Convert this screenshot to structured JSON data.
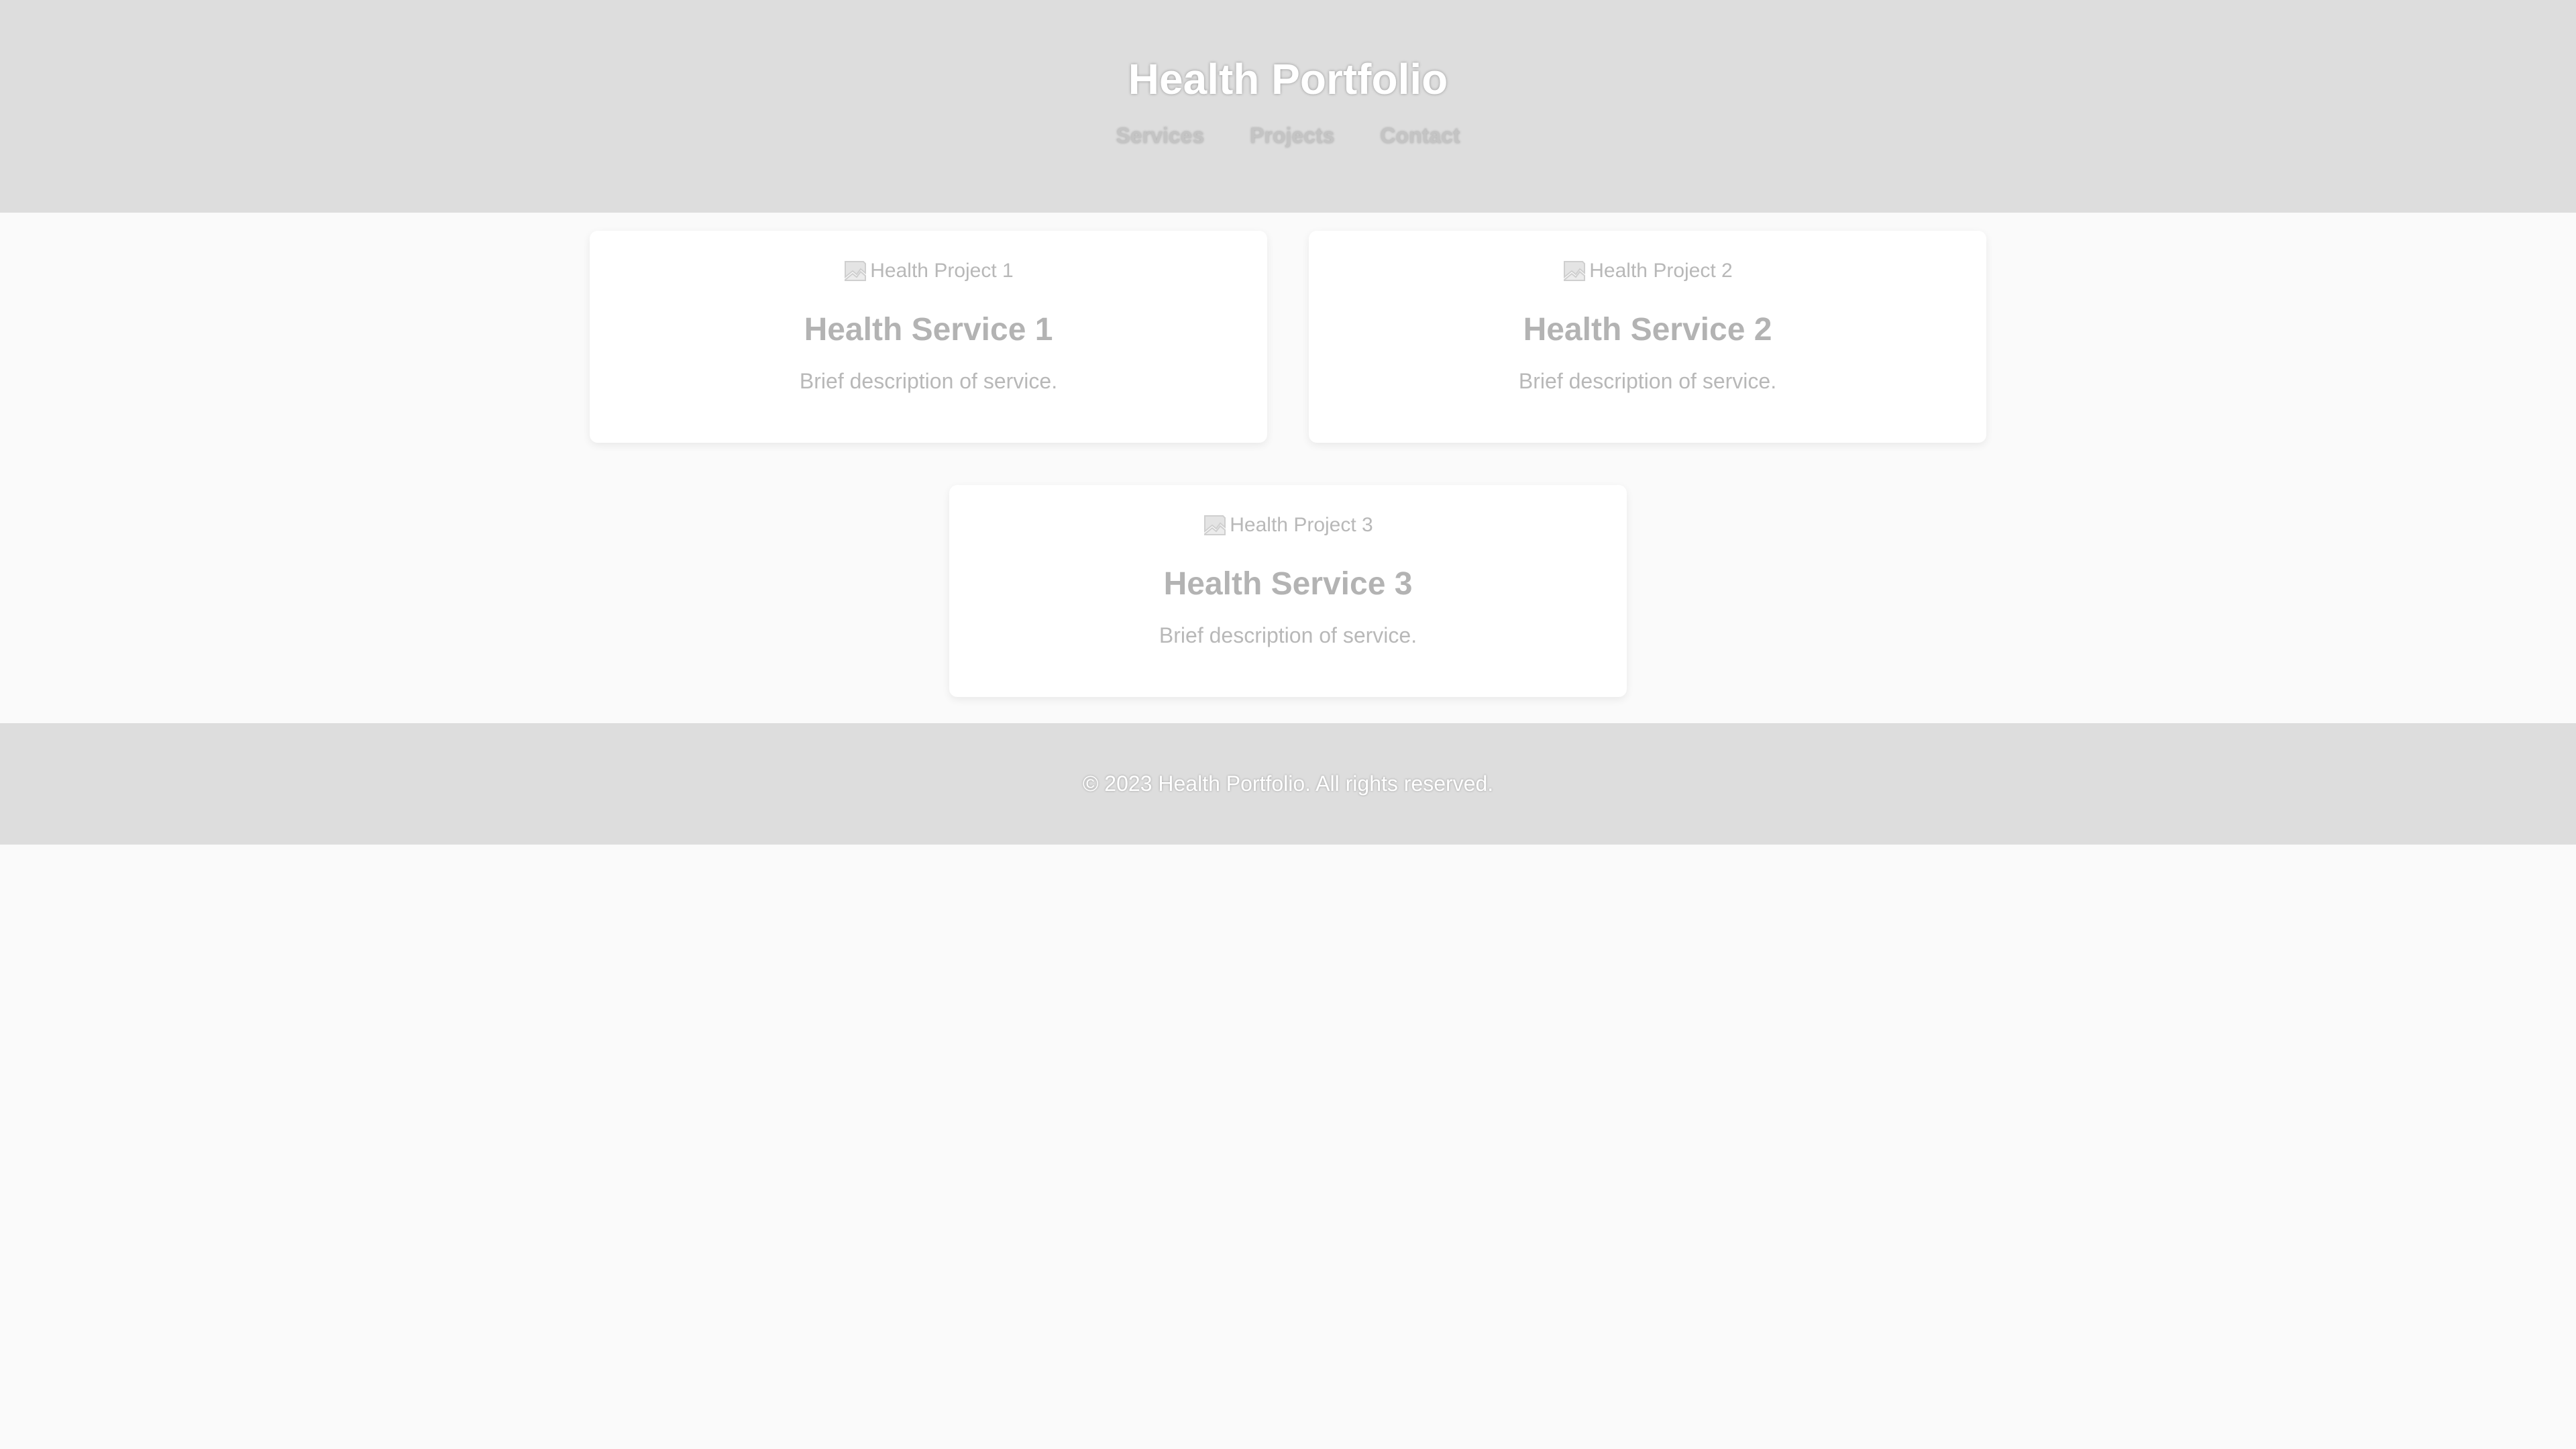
{
  "header": {
    "title": "Health Portfolio",
    "nav": [
      {
        "label": "Services"
      },
      {
        "label": "Projects"
      },
      {
        "label": "Contact"
      }
    ]
  },
  "cards": [
    {
      "image_alt": "Health Project 1",
      "title": "Health Service 1",
      "description": "Brief description of service."
    },
    {
      "image_alt": "Health Project 2",
      "title": "Health Service 2",
      "description": "Brief description of service."
    },
    {
      "image_alt": "Health Project 3",
      "title": "Health Service 3",
      "description": "Brief description of service."
    }
  ],
  "footer": {
    "text": "© 2023 Health Portfolio. All rights reserved."
  },
  "colors": {
    "header_bg": "#dddddd",
    "page_bg": "#fafafa",
    "card_bg": "#ffffff"
  }
}
